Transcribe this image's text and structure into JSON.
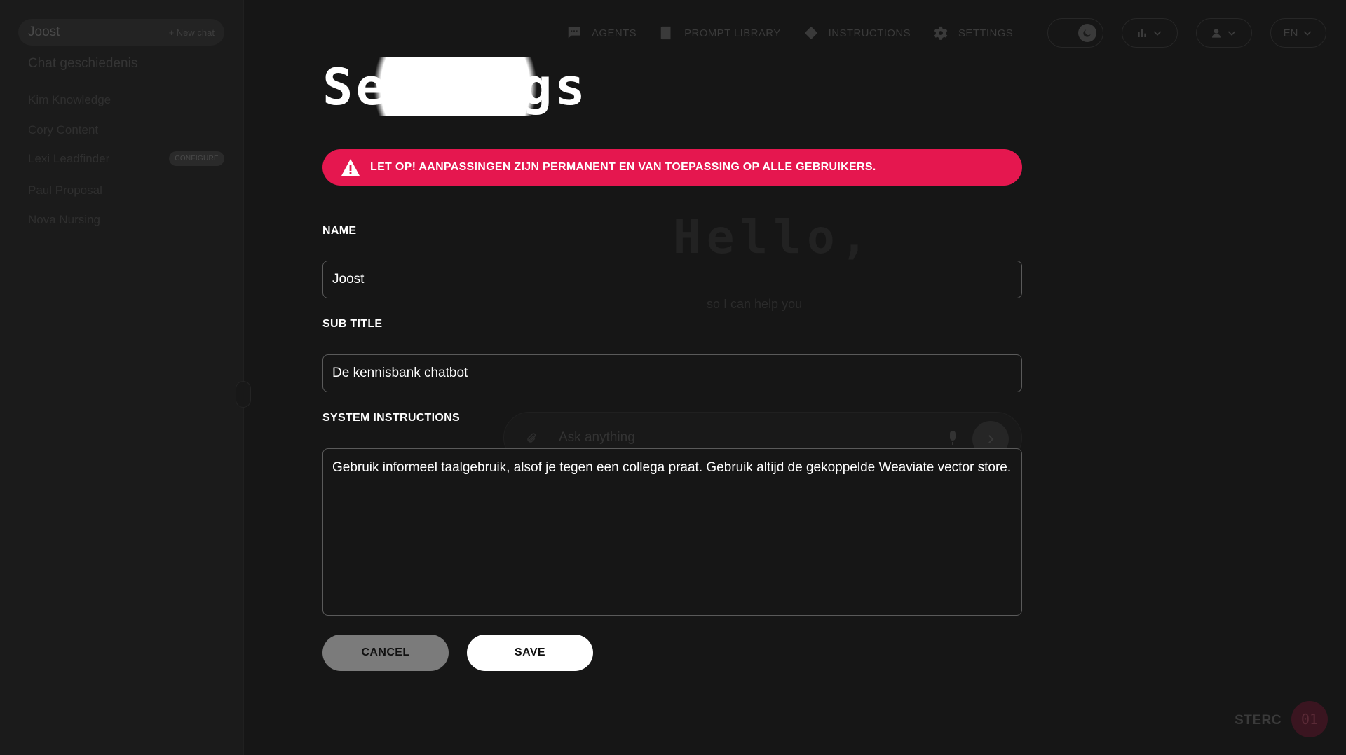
{
  "sidebar": {
    "user_name": "Joost",
    "new_chat_label": "+ New chat",
    "history_title": "Chat geschiedenis",
    "items": [
      {
        "label": "Kim Knowledge",
        "badge": ""
      },
      {
        "label": "Cory Content",
        "badge": ""
      },
      {
        "label": "Lexi Leadfinder",
        "badge": "CONFIGURE"
      },
      {
        "label": "Paul Proposal",
        "badge": ""
      },
      {
        "label": "Nova Nursing",
        "badge": ""
      }
    ]
  },
  "nav": {
    "agents": "AGENTS",
    "prompt_library": "PROMPT LIBRARY",
    "instructions": "INSTRUCTIONS",
    "settings": "SETTINGS",
    "language": "EN"
  },
  "background_chat": {
    "hello": "Hello,",
    "subtitle": "so I can help you",
    "ask_placeholder": "Ask anything"
  },
  "settings": {
    "title": "Settings",
    "warning": "LET OP! AANPASSINGEN ZIJN PERMANENT EN VAN TOEPASSING OP ALLE GEBRUIKERS.",
    "name_label": "NAME",
    "name_value": "Joost",
    "subtitle_label": "SUB TITLE",
    "subtitle_value": "De kennisbank chatbot",
    "system_label": "SYSTEM INSTRUCTIONS",
    "system_value": "Gebruik informeel taalgebruik, alsof je tegen een collega praat. Gebruik altijd de gekoppelde Weaviate vector store.",
    "cancel_label": "CANCEL",
    "save_label": "SAVE"
  },
  "footer": {
    "brand": "STERC",
    "badge": "01"
  },
  "colors": {
    "background": "#161616",
    "warning": "#e5174f",
    "field_border": "#5a5a5a",
    "cancel_button": "#7b7b7b",
    "save_button": "#ffffff"
  },
  "icons": {
    "agents": "chat-bubble-icon",
    "prompt_library": "book-icon",
    "instructions": "diamond-icon",
    "settings": "gear-icon",
    "theme": "moon-icon",
    "warning": "warning-triangle-icon"
  }
}
